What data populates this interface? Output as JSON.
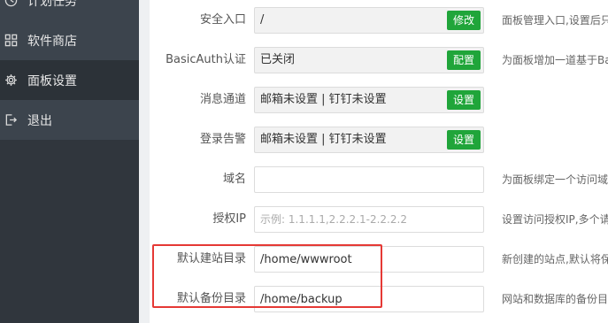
{
  "sidebar": {
    "items": [
      {
        "label": "计划任务",
        "icon": "clock-icon"
      },
      {
        "label": "软件商店",
        "icon": "grid-icon"
      },
      {
        "label": "面板设置",
        "icon": "gear-icon"
      },
      {
        "label": "退出",
        "icon": "logout-icon"
      }
    ],
    "active_index": 2
  },
  "form": {
    "rows": [
      {
        "label": "安全入口",
        "value": "/",
        "button": "修改",
        "hint": "面板管理入口,设置后只"
      },
      {
        "label": "BasicAuth认证",
        "value": "已关闭",
        "button": "配置",
        "hint": "为面板增加一道基于Ba"
      },
      {
        "label": "消息通道",
        "value": "邮箱未设置 | 钉钉未设置",
        "button": "设置",
        "hint": ""
      },
      {
        "label": "登录告警",
        "value": "邮箱未设置 | 钉钉未设置",
        "button": "设置",
        "hint": ""
      },
      {
        "label": "域名",
        "value": "",
        "placeholder": "",
        "hint": "为面板绑定一个访问域"
      },
      {
        "label": "授权IP",
        "value": "",
        "placeholder": "示例: 1.1.1.1,2.2.2.1-2.2.2.2",
        "hint": "设置访问授权IP,多个请"
      },
      {
        "label": "默认建站目录",
        "value": "/home/wwwroot",
        "hint": "新创建的站点,默认将保"
      },
      {
        "label": "默认备份目录",
        "value": "/home/backup",
        "hint": "网站和数据库的备份目"
      }
    ]
  },
  "colors": {
    "sidebar_bg": "#3c444d",
    "sidebar_active": "#2c3238",
    "button_green": "#20a53a",
    "highlight_red": "#e53935"
  }
}
